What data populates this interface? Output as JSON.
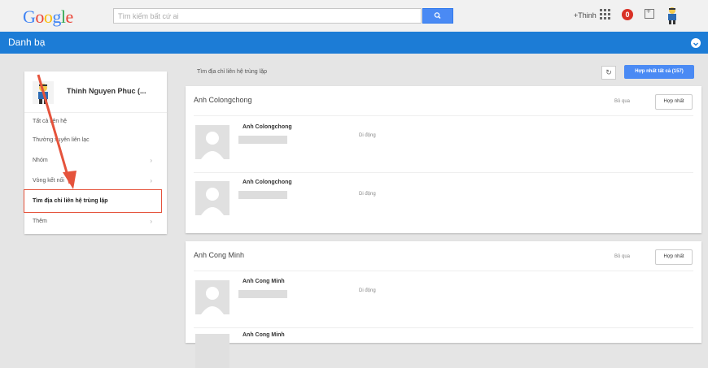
{
  "header": {
    "logo": "Google",
    "search_placeholder": "Tìm kiếm bất cứ ai",
    "plus_label": "+Thinh",
    "notification_count": "0",
    "brand_color": "#1c7cd6"
  },
  "appbar": {
    "title": "Danh bạ"
  },
  "sidebar": {
    "profile_name": "Thinh Nguyen Phuc (...",
    "items": [
      {
        "label": "Tất cả liên hệ",
        "chevron": ""
      },
      {
        "label": "Thường xuyên liên lạc",
        "chevron": ""
      },
      {
        "label": "Nhóm",
        "chevron": "›"
      },
      {
        "label": "Vòng kết nối",
        "chevron": "›"
      },
      {
        "label": "Tìm địa chỉ liên hệ trùng lặp",
        "chevron": ""
      },
      {
        "label": "Thêm",
        "chevron": "›"
      }
    ]
  },
  "main": {
    "section_title": "Tìm địa chỉ liên hệ trùng lặp",
    "merge_all_label": "Hợp nhất tất cả (157)",
    "groups": [
      {
        "title": "Anh Colongchong",
        "skip_label": "Bỏ qua",
        "merge_label": "Hợp nhất",
        "contacts": [
          {
            "name": "Anh Colongchong",
            "phone": "Di động"
          },
          {
            "name": "Anh Colongchong",
            "phone": "Di động"
          }
        ]
      },
      {
        "title": "Anh Cong Minh",
        "skip_label": "Bỏ qua",
        "merge_label": "Hợp nhất",
        "contacts": [
          {
            "name": "Anh Cong Minh",
            "phone": "Di động"
          },
          {
            "name": "Anh Cong Minh",
            "phone": ""
          }
        ]
      }
    ]
  }
}
